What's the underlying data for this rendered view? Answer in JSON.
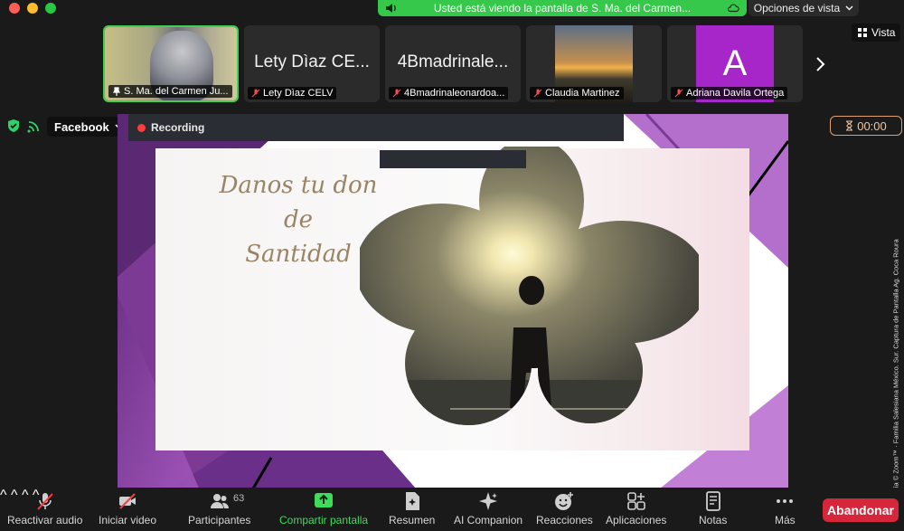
{
  "window": {
    "buttons": [
      "close",
      "minimize",
      "zoom"
    ]
  },
  "banner": {
    "text": "Usted está viendo la pantalla de S. Ma. del Carmen...",
    "view_options": "Opciones de vista"
  },
  "gallery": {
    "tiles": [
      {
        "name": "S. Ma. del Carmen Ju...",
        "big": "",
        "muted": false,
        "pinned": true,
        "active": true
      },
      {
        "name": "Lety Dìaz CELV",
        "big": "Lety Dìaz CE...",
        "muted": true
      },
      {
        "name": "4Bmadrinaleonardoa...",
        "big": "4Bmadrinale...",
        "muted": true
      },
      {
        "name": "Claudia Martinez",
        "big": "",
        "muted": true
      },
      {
        "name": "Adriana Davila Ortega",
        "big": "",
        "avatar_letter": "A",
        "muted": true
      }
    ],
    "vista_label": "Vista"
  },
  "status": {
    "facebook_label": "Facebook",
    "recording_label": "Recording",
    "timer": "00:00"
  },
  "slide": {
    "title_line1": "Danos tu don de",
    "title_line2": "Santidad"
  },
  "watermark": "Cortesía © Zoom™ · Familia Salesiana México. Sur. Captura de Pantalla Ag. Coca Roura",
  "toolbar": {
    "audio": "Reactivar audio",
    "video": "Iniciar video",
    "participants": "Participantes",
    "participants_count": "63",
    "share": "Compartir pantalla",
    "summary": "Resumen",
    "ai": "AI Companion",
    "reactions": "Reacciones",
    "apps": "Aplicaciones",
    "notes": "Notas",
    "more": "Más",
    "leave": "Abandonar"
  },
  "colors": {
    "share_green": "#35c84a",
    "leave_red": "#d6263b",
    "slide_purple": "#8a3fa3",
    "avatar_purple": "#a626c9"
  }
}
